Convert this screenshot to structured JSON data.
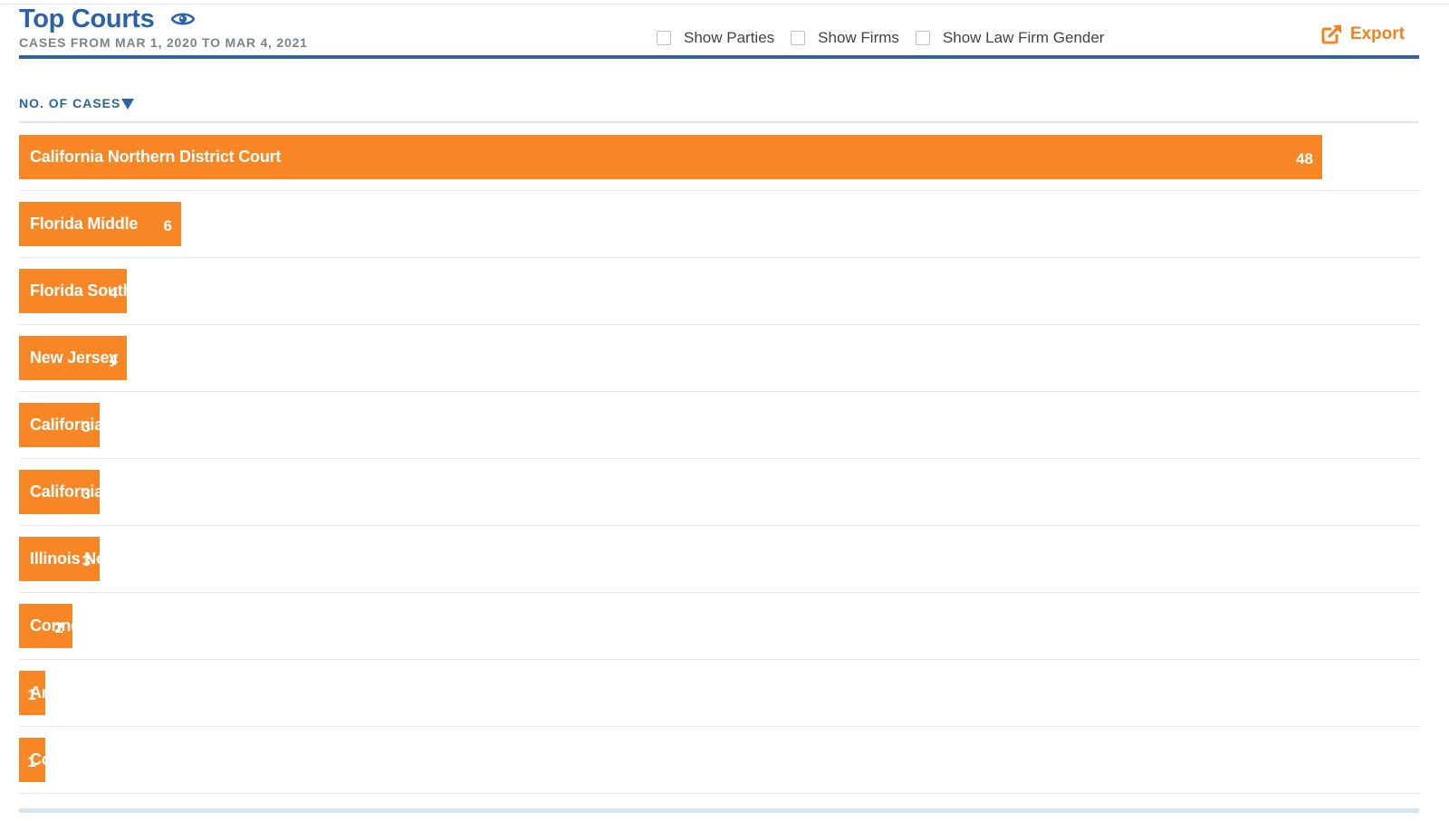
{
  "header": {
    "title": "Top Courts",
    "subtitle": "CASES FROM MAR 1, 2020 TO MAR 4, 2021",
    "title_icon": "eye-icon",
    "options": [
      {
        "label": "Show Parties",
        "checked": false
      },
      {
        "label": "Show Firms",
        "checked": false
      },
      {
        "label": "Show Law Firm Gender",
        "checked": false
      }
    ],
    "export_label": "Export",
    "export_icon": "external-link-icon"
  },
  "sort": {
    "label": "NO. OF CASES",
    "direction": "descending",
    "icon": "caret-down-icon"
  },
  "colors": {
    "accent_blue": "#2a63ac",
    "bar_orange": "#f88625",
    "export_orange": "#f5821f"
  },
  "chart_data": {
    "type": "bar",
    "orientation": "horizontal",
    "categories": [
      "California Northern District Court",
      "Florida Middle",
      "Florida Southern",
      "New Jersey",
      "California Central",
      "California",
      "Illinois Northern",
      "Connecticut",
      "Arkansas Eastern",
      "Colorado District"
    ],
    "values": [
      48,
      6,
      4,
      4,
      3,
      3,
      3,
      2,
      1,
      1
    ],
    "title": "Top Courts",
    "subtitle": "CASES FROM MAR 1, 2020 TO MAR 4, 2021",
    "data_labels": true,
    "grid": true
  }
}
